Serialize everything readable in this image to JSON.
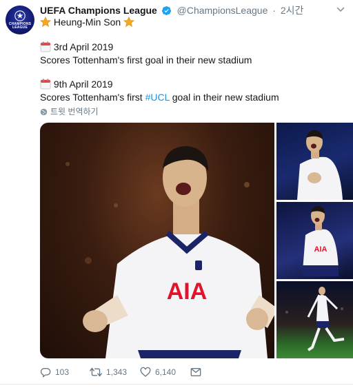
{
  "tweet": {
    "author": {
      "display_name": "UEFA Champions League",
      "handle": "@ChampionsLeague",
      "avatar_text": "CHAMPIONS LEAGUE",
      "verified": true
    },
    "time": "2시간",
    "subtitle_name": "Heung-Min Son",
    "entries": [
      {
        "date": "3rd April 2019",
        "text": "Scores Tottenham's first goal in their new stadium"
      },
      {
        "date": "9th April 2019",
        "text_before": "Scores Tottenham's first ",
        "hashtag": "#UCL",
        "text_after": " goal in their new stadium"
      }
    ],
    "translate_label": "트윗 번역하기",
    "photo_text": {
      "sponsor": "AIA"
    },
    "stats": {
      "replies": "103",
      "retweets": "1,343",
      "likes": "6,140"
    },
    "colors": {
      "link": "#1b95e0",
      "verified": "#1da1f2",
      "muted": "#657786",
      "text": "#14171a"
    },
    "icons": [
      "verified-icon",
      "caret-down-icon",
      "star-emoji",
      "calendar-emoji",
      "globe-icon",
      "reply-icon",
      "retweet-icon",
      "like-icon",
      "dm-icon"
    ]
  }
}
